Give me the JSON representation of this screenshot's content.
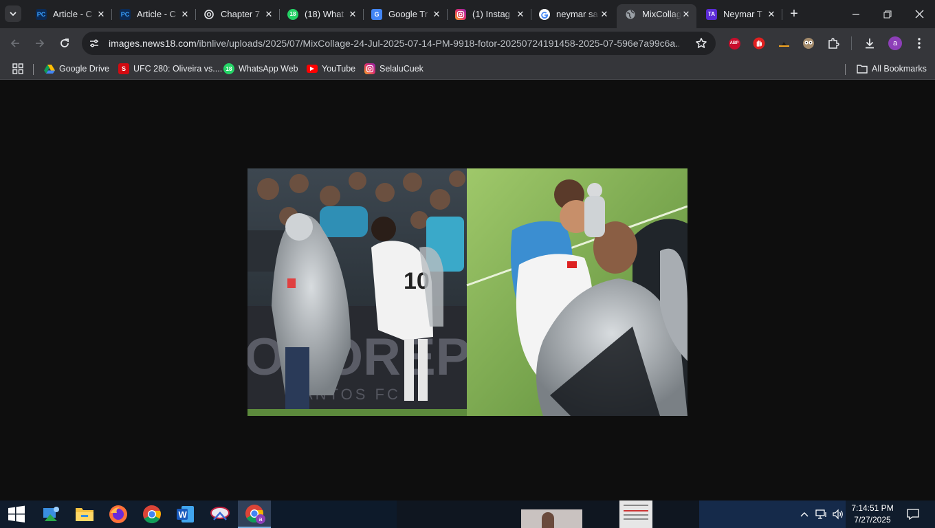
{
  "tabs": [
    {
      "title": "Article - C",
      "icon": "pc-icon",
      "color": "#1a73e8"
    },
    {
      "title": "Article - C",
      "icon": "pc-icon",
      "color": "#1a73e8"
    },
    {
      "title": "Chapter 7",
      "icon": "chatgpt-icon",
      "color": "#e8eaed"
    },
    {
      "title": "(18) What",
      "icon": "whatsapp-icon",
      "color": "#25d366"
    },
    {
      "title": "Google Tr",
      "icon": "google-translate-icon",
      "color": "#4285f4"
    },
    {
      "title": "(1) Instag",
      "icon": "instagram-icon",
      "color": "#e1306c"
    },
    {
      "title": "neymar sa",
      "icon": "google-icon",
      "color": "#ffffff"
    },
    {
      "title": "MixCollag",
      "icon": "globe-icon",
      "color": "#9aa0a6"
    },
    {
      "title": "Neymar T",
      "icon": "ta-icon",
      "color": "#5b2bd6"
    }
  ],
  "tab_whatsapp_badge": "18",
  "tab_ta_badge": "TA",
  "address_bar": {
    "host": "images.news18.com",
    "path": "/ibnlive/uploads/2025/07/MixCollage-24-Jul-2025-07-14-PM-9918-fotor-20250724191458-2025-07-596e7a99c6a..."
  },
  "extensions": {
    "abp_label": "ABP",
    "profile_initial": "a"
  },
  "bookmarks": [
    {
      "label": "Google Drive",
      "icon": "google-drive-icon"
    },
    {
      "label": "UFC 280: Oliveira vs....",
      "icon": "ufc-icon"
    },
    {
      "label": "WhatsApp Web",
      "icon": "whatsapp-icon"
    },
    {
      "label": "YouTube",
      "icon": "youtube-icon"
    },
    {
      "label": "SelaluCuek",
      "icon": "instagram-icon"
    }
  ],
  "bookmark_ufc_mark": "S",
  "all_bookmarks": "All Bookmarks",
  "image": {
    "left_banner_text": "OUOREP",
    "left_banner_sub": "ANTOS FC",
    "jersey_number": "10"
  },
  "taskbar": {
    "time": "7:14:51 PM",
    "date": "7/27/2025"
  }
}
